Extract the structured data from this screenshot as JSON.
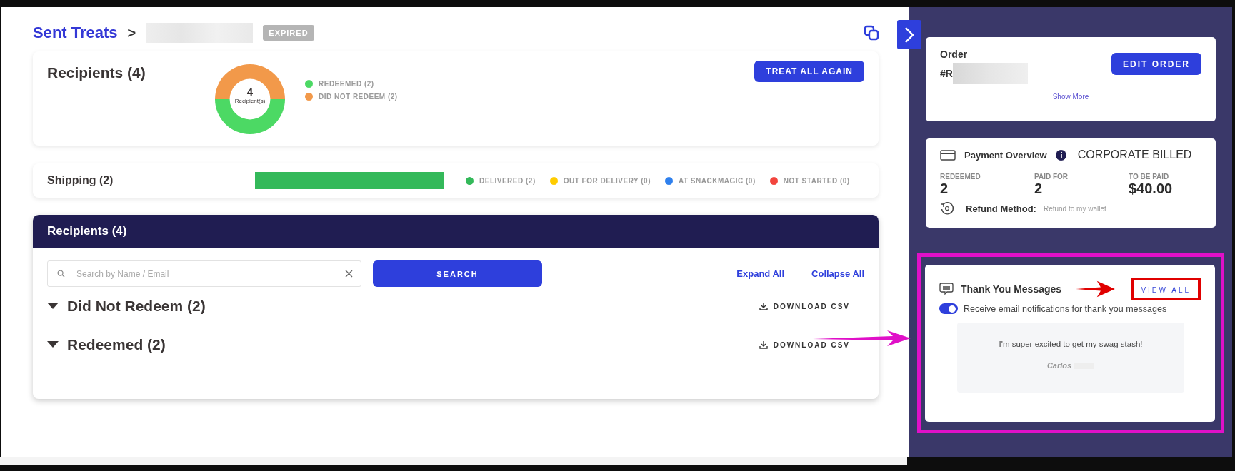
{
  "breadcrumb": {
    "link": "Sent Treats",
    "separator": ">",
    "status_badge": "EXPIRED"
  },
  "summary": {
    "title": "Recipients (4)",
    "center_value": "4",
    "center_label": "Recipient(s)",
    "button": "TREAT ALL AGAIN",
    "legend": [
      {
        "color": "#4cd964"
      },
      {
        "color": "#f2994a"
      }
    ],
    "chart_data": {
      "type": "donut",
      "categories": [
        "REDEEMED (2)",
        "DID NOT REDEEM (2)"
      ],
      "values": [
        2,
        2
      ]
    }
  },
  "shipping": {
    "title": "Shipping (2)",
    "level": 1,
    "legend": [
      {
        "label": "DELIVERED (2)",
        "color": "#34b95a"
      },
      {
        "label": "OUT FOR DELIVERY (0)",
        "color": "#ffcc00"
      },
      {
        "label": "AT SNACKMAGIC (0)",
        "color": "#2f80ed"
      },
      {
        "label": "NOT STARTED (0)",
        "color": "#f2453d"
      }
    ]
  },
  "recipients_panel": {
    "title": "Recipients (4)",
    "search": {
      "placeholder": "Search by Name / Email"
    },
    "search_button": "SEARCH",
    "links": [
      "Expand All",
      "Collapse All"
    ],
    "groups": [
      {
        "title": "Did Not Redeem (2)",
        "action": "DOWNLOAD CSV"
      },
      {
        "title": "Redeemed (2)",
        "action": "DOWNLOAD CSV"
      }
    ]
  },
  "sidebar": {
    "order": {
      "label": "Order",
      "number": "#R",
      "button": "EDIT ORDER",
      "link": "Show More"
    },
    "payment": {
      "title": "Payment Overview",
      "billing": "CORPORATE BILLED",
      "stats": [
        {
          "label": "REDEEMED",
          "value": "2"
        },
        {
          "label": "PAID FOR",
          "value": "2"
        },
        {
          "label": "TO BE PAID",
          "value": "$40.00"
        }
      ],
      "refund_label": "Refund Method:",
      "refund_value": "Refund to my wallet"
    },
    "thank_you": {
      "title": "Thank You Messages",
      "button": "VIEW ALL",
      "toggle": {
        "label": "Receive email notifications for thank you messages",
        "on": true
      },
      "message": {
        "text": "I'm super excited to get my swag stash!",
        "author": "Carlos"
      }
    }
  }
}
